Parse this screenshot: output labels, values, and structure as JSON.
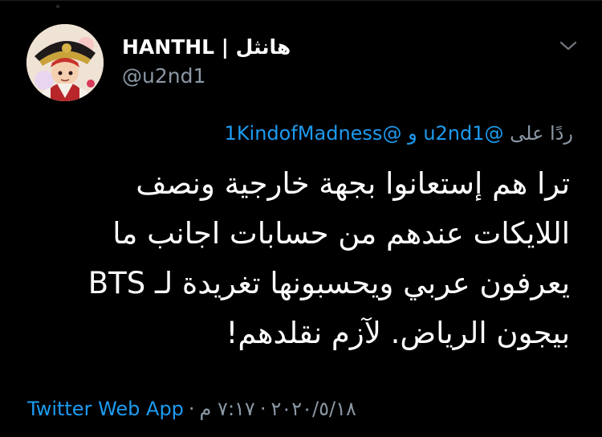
{
  "author": {
    "display_name": "HANTHL | هانثل",
    "handle": "@u2nd1",
    "avatar_icon": "cartoon-character-avatar"
  },
  "reply_context": {
    "prefix": "ردًا على",
    "mention_1": "@u2nd1",
    "connector": "و",
    "mention_2": "@1KindofMadness"
  },
  "tweet": {
    "lines": [
      "ترا هم إستعانوا بجهة خارجية ونصف",
      "اللايكات عندهم من حسابات اجانب ما",
      "يعرفون عربي ويحسبونها تغريدة لـ BTS",
      "بيجون الرياض. لآزم نقلدهم!"
    ]
  },
  "meta": {
    "source": "Twitter Web App",
    "separator": "·",
    "date": "٢٠٢٠/٥/١٨",
    "time": "٧:١٧ م"
  },
  "colors": {
    "background": "#000000",
    "text": "#ffffff",
    "secondary": "#8b98a5",
    "link": "#1d9bf0"
  }
}
